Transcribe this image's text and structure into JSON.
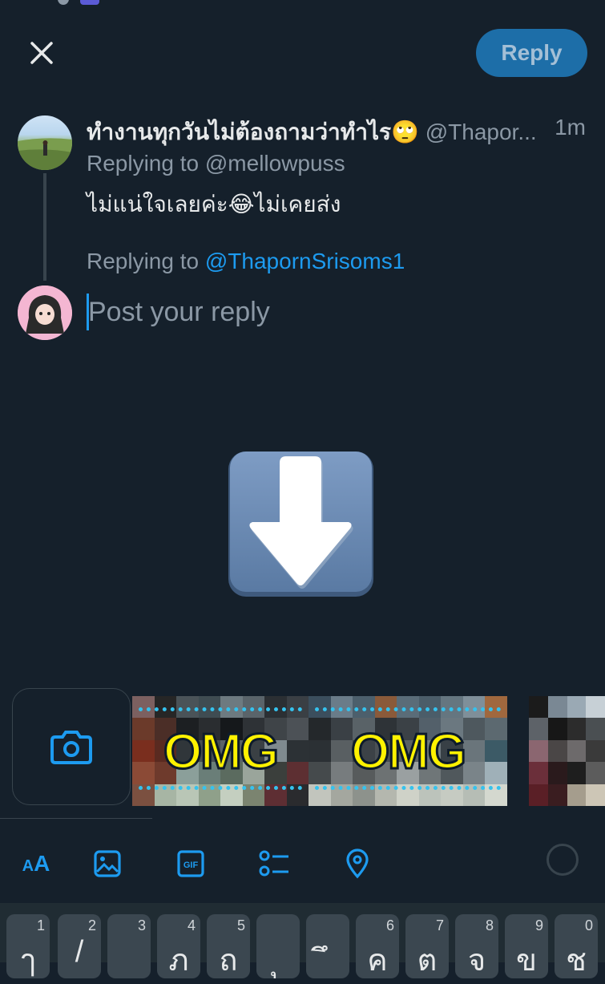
{
  "header": {
    "reply_label": "Reply"
  },
  "post": {
    "author": "ทำงานทุกวันไม่ต้องถามว่าทำไร🙄",
    "handle": "@Thapor...",
    "time": "1m",
    "replying_label": "Replying to",
    "replying_to": "@mellowpuss",
    "text": "ไม่แน่ใจเลยค่ะ😂ไม่เคยส่ง"
  },
  "composer": {
    "replying_label": "Replying to",
    "replying_to": "@ThapornSrisoms1",
    "placeholder": "Post your reply"
  },
  "media": {
    "gif1_text": "OMG",
    "gif2_text": "OMG"
  },
  "toolbar": {
    "icons": [
      "text-format-icon",
      "image-icon",
      "gif-icon",
      "poll-icon",
      "location-icon"
    ],
    "aa_label": "AA",
    "gif_label": "GIF"
  },
  "keyboard": {
    "keys": [
      {
        "num": "1",
        "char": "ๅ"
      },
      {
        "num": "2",
        "char": "/"
      },
      {
        "num": "3",
        "char": ""
      },
      {
        "num": "4",
        "char": "ภ"
      },
      {
        "num": "5",
        "char": "ถ"
      },
      {
        "num": "",
        "char": "ุ"
      },
      {
        "num": "",
        "char": "ึ"
      },
      {
        "num": "6",
        "char": "ค"
      },
      {
        "num": "7",
        "char": "ต"
      },
      {
        "num": "8",
        "char": "จ"
      },
      {
        "num": "9",
        "char": "ข"
      },
      {
        "num": "0",
        "char": "ช"
      }
    ]
  },
  "colors": {
    "background": "#15202b",
    "accent": "#1d9bf0",
    "reply_button": "#1d6ea8"
  }
}
